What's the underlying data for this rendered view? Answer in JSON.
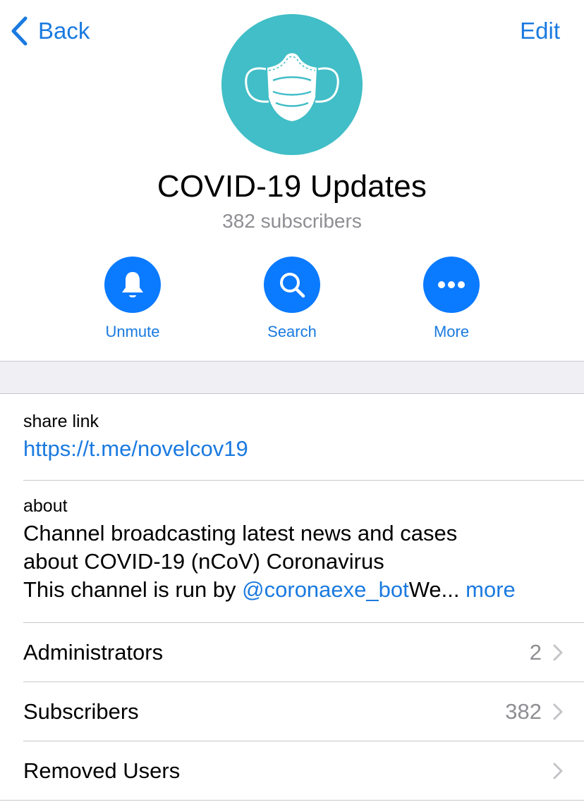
{
  "nav": {
    "back_label": "Back",
    "edit_label": "Edit"
  },
  "channel": {
    "avatar_icon": "face-mask-icon",
    "avatar_color": "#41bec7",
    "title": "COVID-19 Updates",
    "subtitle": "382 subscribers"
  },
  "actions": [
    {
      "label": "Unmute",
      "icon": "bell-icon"
    },
    {
      "label": "Search",
      "icon": "search-icon"
    },
    {
      "label": "More",
      "icon": "more-dots-icon"
    }
  ],
  "info": {
    "share_label": "share link",
    "share_value": "https://t.me/novelcov19",
    "about_label": "about",
    "about_line1": "Channel broadcasting latest news and cases",
    "about_line2": "about COVID-19 (nCoV) Coronavirus",
    "about_line3_prefix": "This channel is run by ",
    "about_mention": "@coronaexe_bot",
    "about_line3_suffix": "We... ",
    "about_more": "more"
  },
  "rows": [
    {
      "label": "Administrators",
      "value": "2"
    },
    {
      "label": "Subscribers",
      "value": "382"
    },
    {
      "label": "Removed Users",
      "value": ""
    }
  ],
  "colors": {
    "accent": "#1a7ae0",
    "button_fill": "#0a7aff",
    "secondary_text": "#8e8e93",
    "group_background": "#efeff4",
    "separator": "#c8c7cc"
  }
}
